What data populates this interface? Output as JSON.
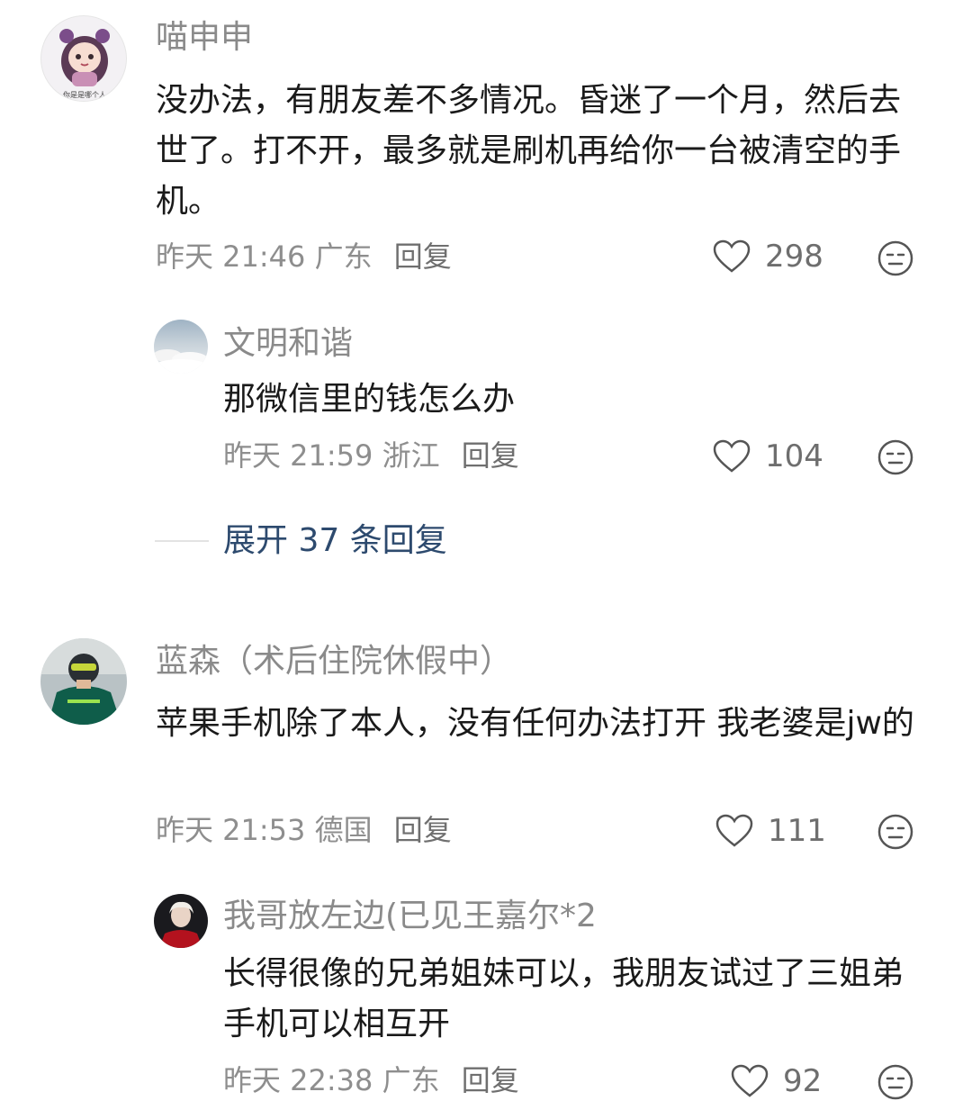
{
  "comments": [
    {
      "user": "喵申申",
      "text": "没办法，有朋友差不多情况。昏迷了一个月，然后去世了。打不开，最多就是刷机再给你一台被清空的手机。",
      "meta": "昨天 21:46 广东",
      "reply": "回复",
      "likes": "298",
      "reply_item": {
        "user": "文明和谐",
        "text": "那微信里的钱怎么办",
        "meta": "昨天 21:59 浙江",
        "reply": "回复",
        "likes": "104"
      },
      "expand": "展开 37 条回复"
    },
    {
      "user": "蓝森（术后住院休假中）",
      "text": "苹果手机除了本人，没有任何办法打开 我老婆是jw的",
      "meta": "昨天 21:53 德国",
      "reply": "回复",
      "likes": "111",
      "reply_item": {
        "user": "我哥放左边(已见王嘉尔*2",
        "text": "长得很像的兄弟姐妹可以，我朋友试过了三姐弟手机可以相互开",
        "meta": "昨天 22:38 广东",
        "reply": "回复",
        "likes": "92"
      }
    }
  ],
  "avatar1_caption": "你是是哪个人",
  "icons": {
    "like": "heart-outline-icon",
    "dislike": "meh-face-icon"
  },
  "colors": {
    "expand_link": "#2d4a6e",
    "muted": "#8a8a8a"
  }
}
